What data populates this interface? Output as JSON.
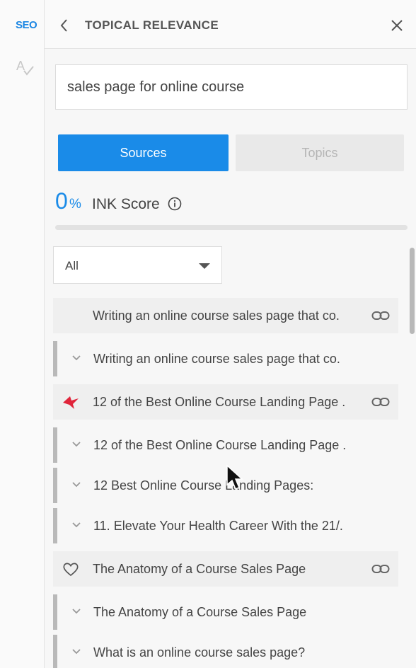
{
  "rail": {
    "seo_label": "SEO",
    "icons": [
      "seo-tab",
      "spellcheck-icon"
    ]
  },
  "header": {
    "title": "TOPICAL RELEVANCE",
    "icons": [
      "chevron-left-icon",
      "close-icon"
    ]
  },
  "query": {
    "value": "sales page for online course"
  },
  "tabs": {
    "sources": "Sources",
    "topics": "Topics",
    "active": "Sources"
  },
  "score": {
    "value": "0",
    "unit": "%",
    "label": "INK Score",
    "progress_fraction": 0
  },
  "filter": {
    "selected": "All"
  },
  "rows": [
    {
      "type": "source",
      "text": "Writing an online course sales page that co.",
      "favicon": "none",
      "link_icon": "link-icon"
    },
    {
      "type": "heading",
      "text": "Writing an online course sales page that co."
    },
    {
      "type": "source",
      "text": "12 of the Best Online Course Landing Page .",
      "favicon": "red-bird-favicon",
      "link_icon": "link-icon"
    },
    {
      "type": "heading",
      "text": "12 of the Best Online Course Landing Page ."
    },
    {
      "type": "heading",
      "text": "12 Best Online Course Landing Pages:"
    },
    {
      "type": "heading",
      "text": "11. Elevate Your Health Career With the 21/."
    },
    {
      "type": "source",
      "text": "The Anatomy of a Course Sales Page",
      "favicon": "heart-outline-favicon",
      "link_icon": "link-icon"
    },
    {
      "type": "heading",
      "text": "The Anatomy of a Course Sales Page"
    },
    {
      "type": "heading",
      "text": "What is an online course sales page?"
    }
  ],
  "colors": {
    "accent": "#1a8be8",
    "inactive_tab": "#e9e9e9",
    "source_row_bg": "#efefef",
    "heading_bar": "#b9b9b9"
  }
}
